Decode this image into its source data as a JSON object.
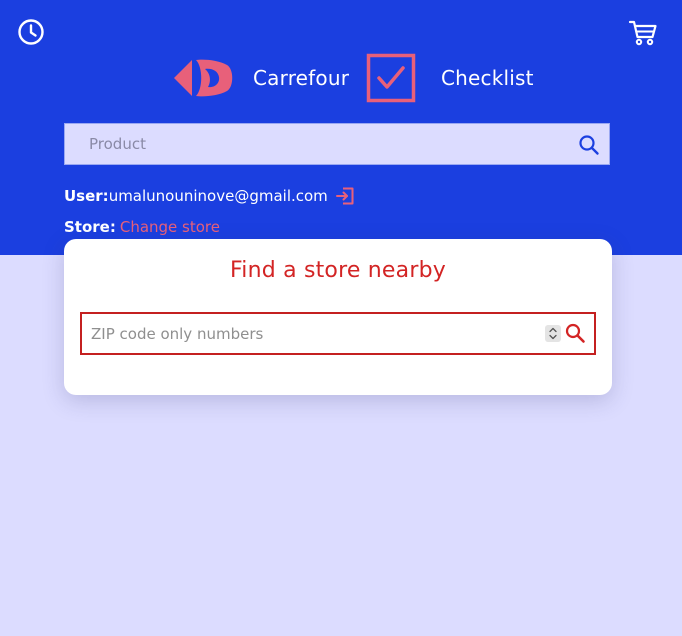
{
  "header": {
    "brand_name": "Carrefour",
    "app_name": "Checklist",
    "history_icon": "clock-icon",
    "cart_icon": "cart-icon"
  },
  "search": {
    "placeholder": "Product",
    "value": "",
    "icon": "search-icon"
  },
  "user": {
    "label": "User:",
    "email": "umalunouninove@gmail.com",
    "logout_icon": "logout-icon"
  },
  "store": {
    "label": "Store:",
    "change_label": "Change store"
  },
  "modal": {
    "title": "Find a store nearby",
    "zip_placeholder": "ZIP code only numbers",
    "zip_value": "",
    "search_icon": "search-icon"
  },
  "colors": {
    "header_bg": "#1b3fe0",
    "page_bg": "#dcdcff",
    "accent_pink": "#e8607a",
    "modal_title": "#d32424",
    "zip_border": "#c42020"
  }
}
